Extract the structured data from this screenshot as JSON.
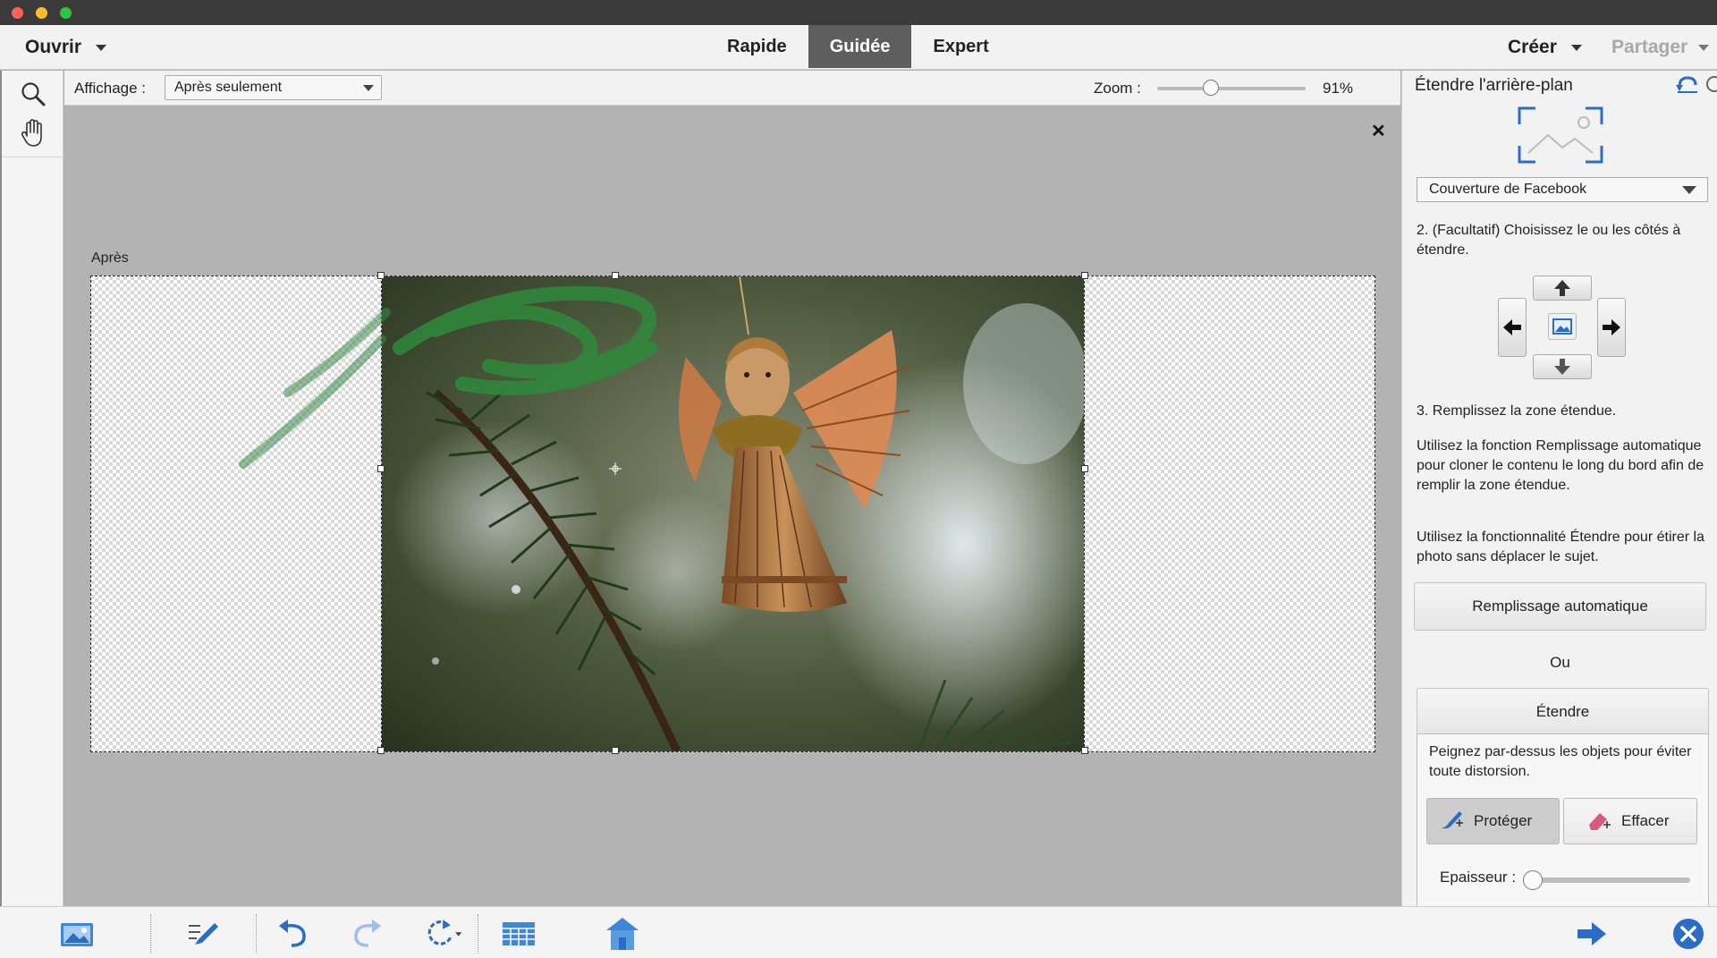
{
  "menubar": {
    "open_label": "Ouvrir",
    "modes": [
      "Rapide",
      "Guidée",
      "Expert"
    ],
    "active_mode": "Guidée",
    "create_label": "Créer",
    "share_label": "Partager"
  },
  "lefttools": {
    "icons": [
      "zoom-icon",
      "hand-icon"
    ]
  },
  "options": {
    "view_label": "Affichage :",
    "view_value": "Après seulement",
    "zoom_label": "Zoom :",
    "zoom_value": "91%",
    "zoom_fraction": 0.36
  },
  "canvas": {
    "close_symbol": "✕",
    "after_label": "Après"
  },
  "panel": {
    "title": "Étendre l'arrière-plan",
    "preset_value": "Couverture de Facebook",
    "step2": "2. (Facultatif) Choisissez le ou les côtés à étendre.",
    "step3": "3. Remplissez la zone étendue.",
    "desc_autofill": "Utilisez la fonction Remplissage automatique pour cloner le contenu le long du bord afin de remplir la zone étendue.",
    "desc_extend": "Utilisez la fonctionnalité Étendre pour étirer la photo sans déplacer le sujet.",
    "autofill_button": "Remplissage automatique",
    "or_label": "Ou",
    "extend_button": "Étendre",
    "paint_hint": "Peignez par-dessus les objets pour éviter toute distorsion.",
    "protect_button": "Protéger",
    "erase_button": "Effacer",
    "thickness_label": "Epaisseur :",
    "thickness_fraction": 0.06
  },
  "bottombar": {
    "icons": [
      "photo-bin-icon",
      "tool-options-icon",
      "undo-icon",
      "redo-icon",
      "rotate-icon",
      "organizer-icon",
      "home-screen-icon",
      "next-arrow-icon",
      "cancel-icon"
    ]
  },
  "colors": {
    "active_tab": "#5e5e5e",
    "accent_blue": "#2b6cc4",
    "canvas_bg": "#b3b3b3"
  }
}
